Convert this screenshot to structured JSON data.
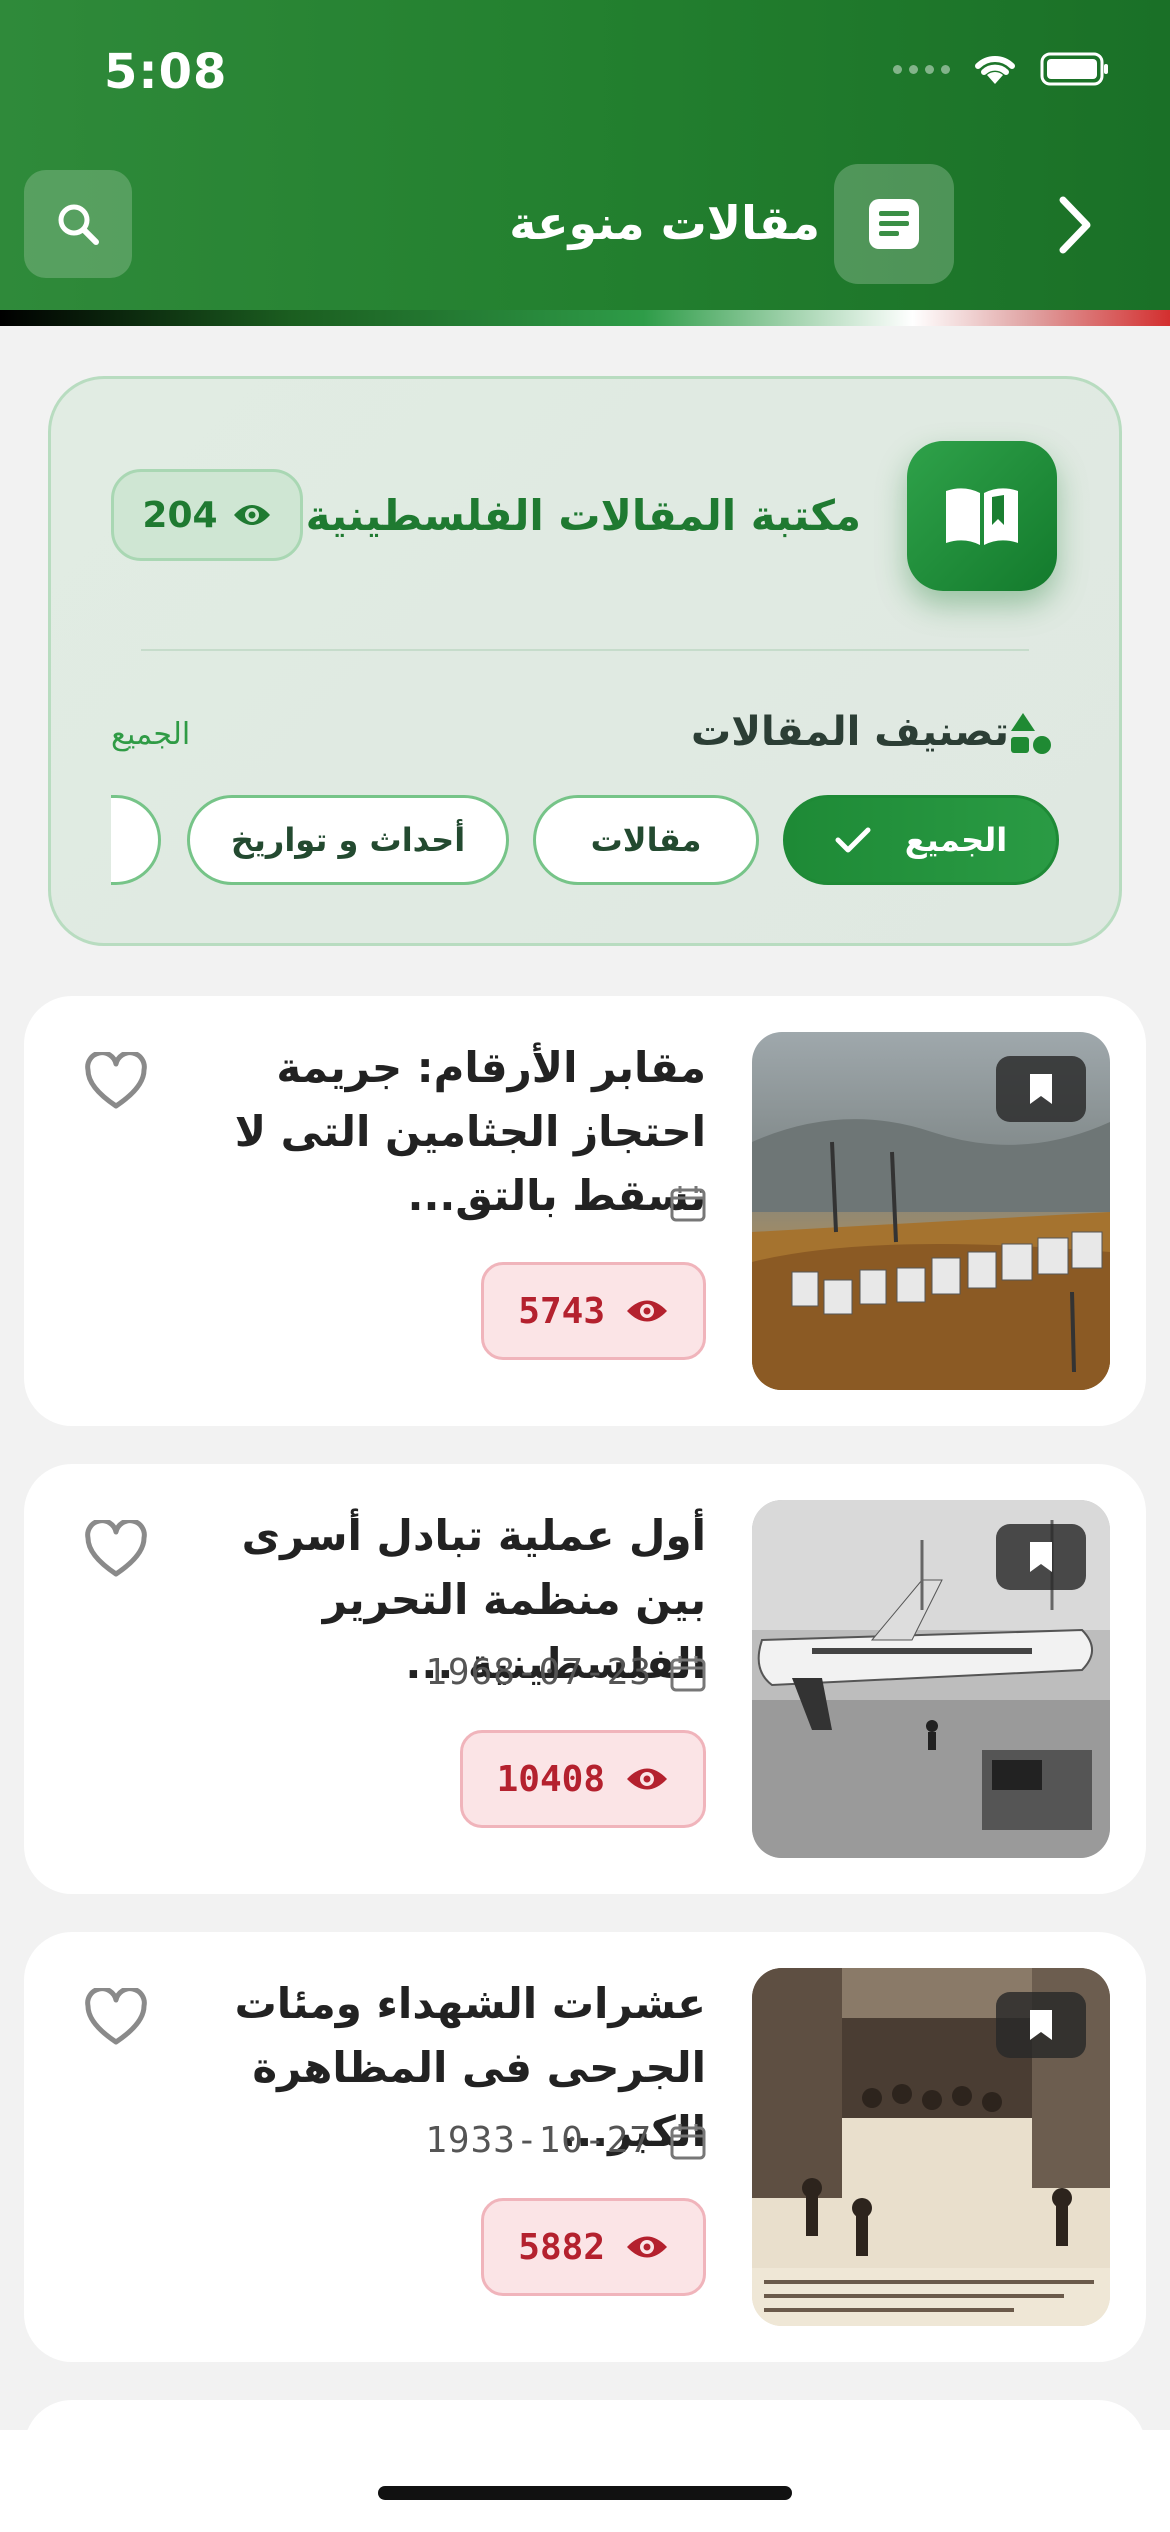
{
  "status_bar": {
    "time": "5:08"
  },
  "header": {
    "title": "مقالات منوعة"
  },
  "library": {
    "title": "مكتبة المقالات الفلسطينية",
    "count": "204",
    "category_heading": "تصنيف المقالات",
    "current_category": "الجميع",
    "chips": [
      {
        "label": "الجميع",
        "active": true
      },
      {
        "label": "مقالات",
        "active": false
      },
      {
        "label": "أحداث و تواريخ",
        "active": false
      },
      {
        "label": "",
        "active": false
      }
    ]
  },
  "articles": [
    {
      "title": "مقابر الأرقام: جريمة احتجاز الجثامين التى لا تسقط بالتق...",
      "date": "",
      "views": "5743",
      "image": "cemetery-number-plates-photo"
    },
    {
      "title": "أول عملية تبادل أسرى بين منظمة التحرير الفلسطينية ...",
      "date": "1968-07-23",
      "views": "10408",
      "image": "airplane-runway-bw-photo"
    },
    {
      "title": "عشرات الشهداء ومئات الجرحى فى المظاهرة الكبر...",
      "date": "1933-10-27",
      "views": "5882",
      "image": "demonstration-archive-photo"
    }
  ],
  "colors": {
    "brand_green": "#23802f",
    "views_red": "#b4212e"
  }
}
